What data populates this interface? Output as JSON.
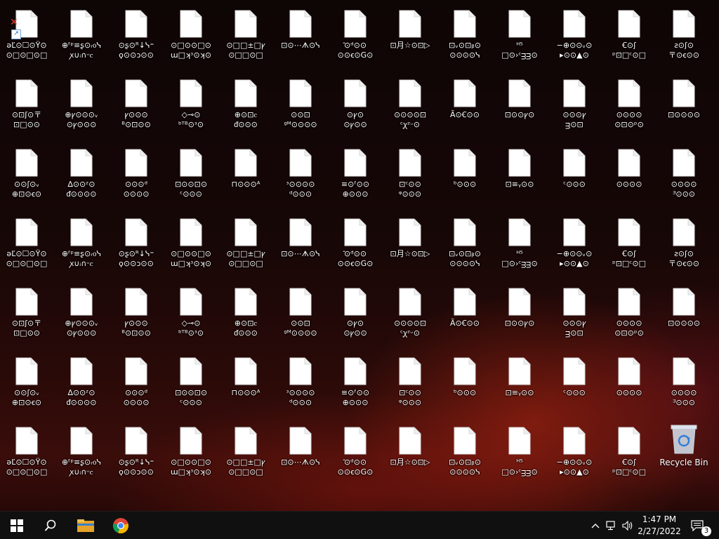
{
  "desktop": {
    "icons": [
      [
        "ǝĽ⊙☐⊙Ÿ⊙",
        "⊙□⊙□⊙□"
      ],
      [
        "⊕ᶠᵖ≡ʂ⊙ᵣ᧐ᓭ",
        "ꭗ∪ᵢ∩ᵕⲥ"
      ],
      [
        "⊙ʂ⊙ᴿ↓ᓭ⁼",
        "ϙ⊙⊙ɔ⊙⊙"
      ],
      [
        "⊙□⊙⊙□⊙",
        "ɯ□ʞᶟ⊙ʞ⊙"
      ],
      [
        "⊙□□±□ꝩ",
        "⊙□□⊙□"
      ],
      [
        "⊡⊙⋯ᗑ⊙ᓭ",
        ""
      ],
      [
        "ꜙ⊙ᵈ⊙⊙",
        "⊙⊙ꞓ⊙G⊙"
      ],
      [
        "⊡月☆⊙⊡▷",
        ""
      ],
      [
        "⊡ᵥ⊙⊡ᵦ⊙",
        "⊙⊙⊙⊙ᓭ"
      ],
      [
        "ᴴ⁵",
        "□⊙›ᶜᴟᴟ⊙"
      ],
      [
        "−⊕⊙⊙ᵥ⊙",
        "▸⊙⊙▲⊙"
      ],
      [
        "Ꞓ⊙ʃ",
        "ᵖ⊡□ᶜ⊙□"
      ],
      [
        "ꙅ⊙ʃ⊙",
        "〒⊙ꞓ⊙⊙"
      ],
      [
        "⊙⊡ʃ⊙〒",
        "⊡□⊙⊙"
      ],
      [
        "⊕ꝩ⊙⊙⊙ᵥ",
        "⊙ꝩ⊙⊙⊙"
      ],
      [
        "ꝩ⊙⊙⊙",
        "ᴮ⊙⊡⊙⊙"
      ],
      [
        "◇⊸⊙",
        "ᵇᵀᴮ⊙ᶟ⊙"
      ],
      [
        "⊕⊙⊡ⲥ",
        "ᵭ⊙⊙⊙"
      ],
      [
        "⊙⊙⊡",
        "ᵍᴹ⊙⊙⊙⊙"
      ],
      [
        "⊙ꝩ⊙",
        "⊙ꝩ⊙⊙"
      ],
      [
        "⊙⊙⊙⊙⊡",
        "ᶜꭕᶻᵕ⊙"
      ],
      [
        "Ã⊙Ꞓ⊙⊙",
        ""
      ],
      [
        "⊡⊙⊙ꝩ⊙",
        ""
      ],
      [
        "⊙⊙⊙ꝩ",
        "ᴟ⊙⊡"
      ],
      [
        "⊙⊙⊙⊙",
        "⊙⊡⊙ᵖ⊙"
      ],
      [
        "⊡⊙⊙⊙⊙",
        ""
      ],
      [
        "⊙⊙ʃ⊙ᵥ",
        "⊕⊡⊙ꞓ⊙"
      ],
      [
        "∆⊙⊙ᶻ⊙",
        "ᵭ⊙⊙⊙⊙"
      ],
      [
        "⊙⊙⊙ᵈ",
        "⊙⊙⊙⊙"
      ],
      [
        "⊡⊙⊙⊡⊙",
        "ᶜ⊙⊙⊙"
      ],
      [
        "⊓⊙⊙⊙ᴬ",
        ""
      ],
      [
        "ᶟ⊙⊙⊙⊙",
        "ᵈ⊙⊙⊙"
      ],
      [
        "≡⊙ᶠ⊙⊙",
        "⊕⊙⊙⊙"
      ],
      [
        "⊡ᶜ⊙⊙",
        "ᵠ⊙⊙⊙"
      ],
      [
        "ᵇ⊙⊙⊙",
        ""
      ],
      [
        "⊡≡ᵧ⊙⊙",
        ""
      ],
      [
        "ᶜ⊙⊙⊙",
        ""
      ],
      [
        "⊙⊙⊙⊙",
        ""
      ],
      [
        "⊙⊙⊙⊙",
        "ᴲ⊙⊙⊙"
      ]
    ]
  },
  "recycle_bin": {
    "label": "Recycle Bin"
  },
  "taskbar": {
    "start_icon": "windows-logo-icon",
    "search_icon": "search-icon",
    "explorer_icon": "file-explorer-icon",
    "chrome_icon": "chrome-icon",
    "tray": [
      "chevron-up-icon",
      "network-icon",
      "volume-icon"
    ]
  },
  "clock": {
    "time": "1:47 PM",
    "date": "2/27/2022"
  },
  "notifications": {
    "count": "3"
  },
  "colors": {
    "taskbar": "#101010",
    "accent": "#0078d7"
  }
}
